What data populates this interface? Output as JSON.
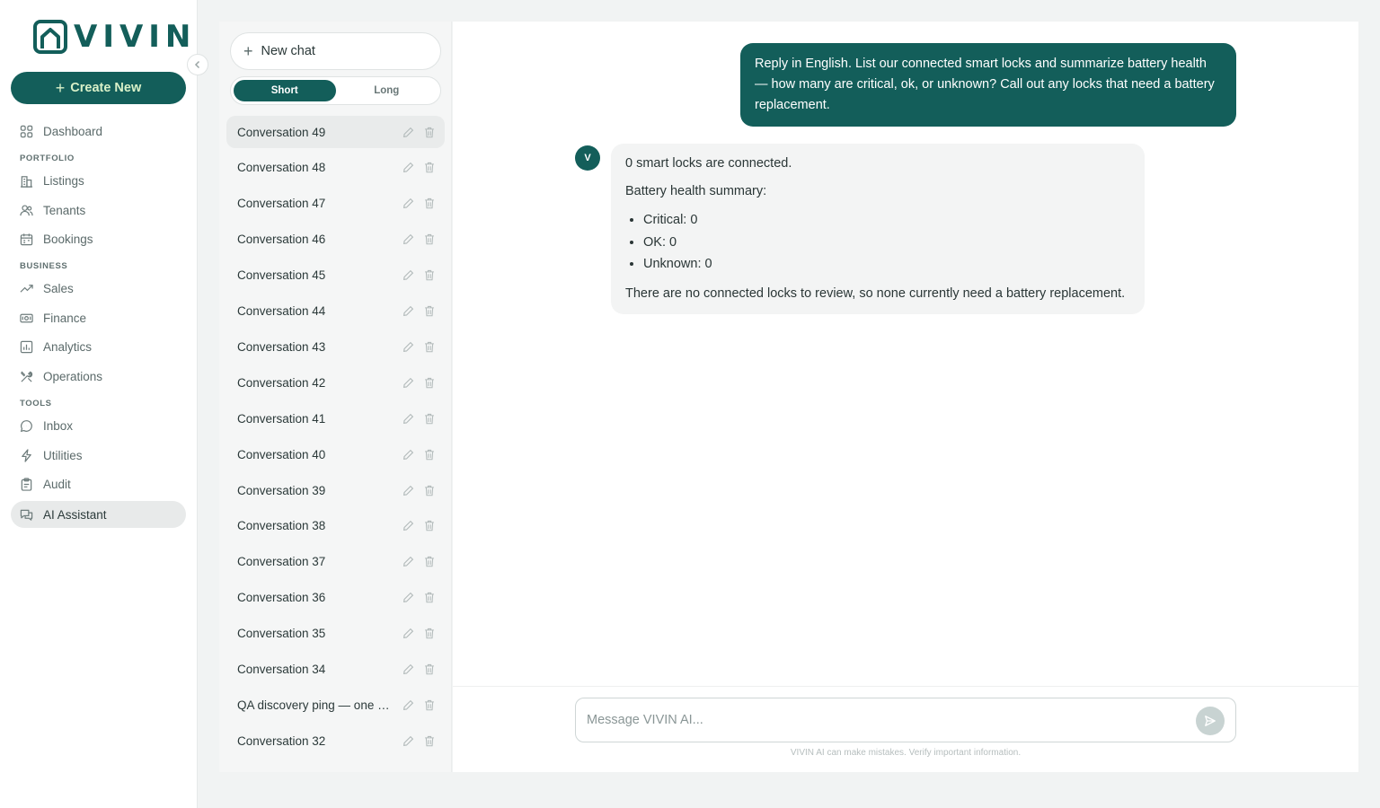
{
  "app": {
    "logo_text": "VIVIN"
  },
  "sidebar": {
    "create_label": "Create New",
    "dashboard": "Dashboard",
    "sections": {
      "portfolio": "PORTFOLIO",
      "business": "BUSINESS",
      "tools": "TOOLS"
    },
    "items": {
      "listings": "Listings",
      "tenants": "Tenants",
      "bookings": "Bookings",
      "sales": "Sales",
      "finance": "Finance",
      "analytics": "Analytics",
      "operations": "Operations",
      "inbox": "Inbox",
      "utilities": "Utilities",
      "audit": "Audit",
      "ai_assistant": "AI Assistant"
    },
    "active_item": "AI Assistant"
  },
  "conversations": {
    "new_chat_label": "New chat",
    "toggle": {
      "short": "Short",
      "long": "Long",
      "selected": "Short"
    },
    "items": [
      "Conversation 49",
      "Conversation 48",
      "Conversation 47",
      "Conversation 46",
      "Conversation 45",
      "Conversation 44",
      "Conversation 43",
      "Conversation 42",
      "Conversation 41",
      "Conversation 40",
      "Conversation 39",
      "Conversation 38",
      "Conversation 37",
      "Conversation 36",
      "Conversation 35",
      "Conversation 34",
      "QA discovery ping — one s...",
      "Conversation 32"
    ],
    "active_index": 0
  },
  "chat": {
    "user_message": "Reply in English. List our connected smart locks and summarize battery health — how many are critical, ok, or unknown? Call out any locks that need a battery replacement.",
    "assistant_avatar": "V",
    "assistant": {
      "line1": "0 smart locks are connected.",
      "line2": "Battery health summary:",
      "bullets": [
        "Critical: 0",
        "OK: 0",
        "Unknown: 0"
      ],
      "line3": "There are no connected locks to review, so none currently need a battery replacement."
    },
    "composer_placeholder": "Message VIVIN AI...",
    "disclaimer": "VIVIN AI can make mistakes. Verify important information."
  },
  "colors": {
    "brand": "#135e5a",
    "create_text": "#d8f0c8",
    "active_nav_bg": "#e8eaea"
  }
}
